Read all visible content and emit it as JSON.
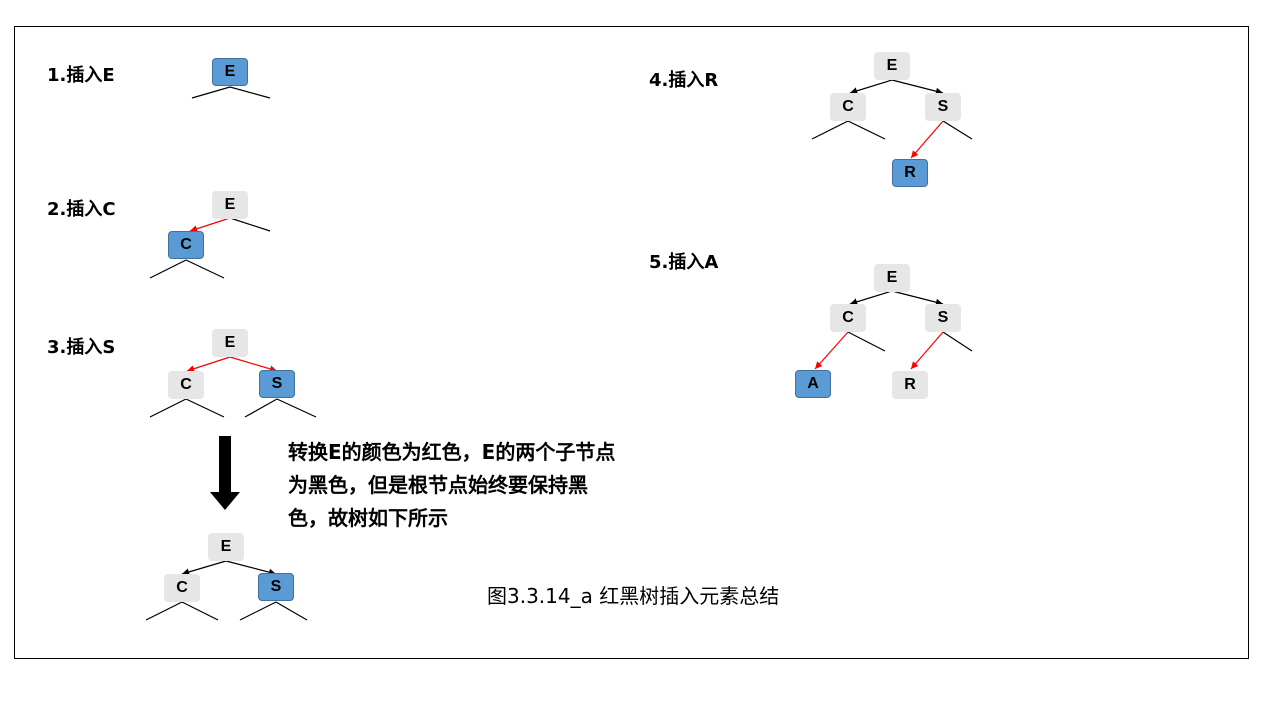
{
  "steps": {
    "s1": "1.插入E",
    "s2": "2.插入C",
    "s3": "3.插入S",
    "s4": "4.插入R",
    "s5": "5.插入A"
  },
  "nodes": {
    "t1_e": "E",
    "t2_e": "E",
    "t2_c": "C",
    "t3_e": "E",
    "t3_c": "C",
    "t3_s": "S",
    "t3b_e": "E",
    "t3b_c": "C",
    "t3b_s": "S",
    "t4_e": "E",
    "t4_c": "C",
    "t4_s": "S",
    "t4_r": "R",
    "t5_e": "E",
    "t5_c": "C",
    "t5_s": "S",
    "t5_a": "A",
    "t5_r": "R"
  },
  "note": "转换E的颜色为红色，E的两个子节点为黑色，但是根节点始终要保持黑色，故树如下所示",
  "caption": "图3.3.14_a 红黑树插入元素总结",
  "colors": {
    "node_black": "#e6e6e6",
    "node_new": "#5b9bd5",
    "edge_black": "#000000",
    "edge_red": "#ff0000"
  }
}
